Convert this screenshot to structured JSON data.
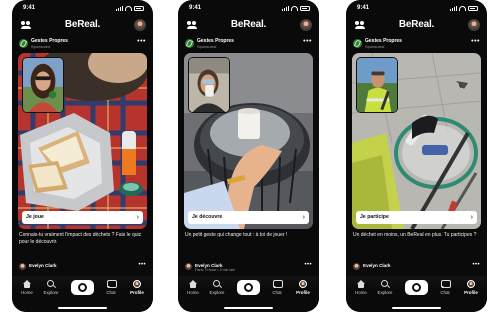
{
  "status_time": "9:41",
  "app_title": "BeReal.",
  "poster": {
    "name": "Gestes Propres",
    "subtitle": "Sponsored"
  },
  "commenter": {
    "name": "Evelyn Clark",
    "subtitle": "Paris, France • 3 min late"
  },
  "nav": {
    "home": "Home",
    "explore": "Explore",
    "chat": "Chat",
    "profile": "Profile"
  },
  "phones": [
    {
      "cta_label": "Je joue",
      "caption": "Connais-tu vraiment l'impact des déchets ? Fais le quiz pour le découvrir."
    },
    {
      "cta_label": "Je découvre",
      "caption": "Un petit geste qui change tout : à toi de jouer !"
    },
    {
      "cta_label": "Je participe",
      "caption": "Un déchet en moins, un BeReal en plus. Tu participes ?"
    }
  ],
  "icons": [
    "friends-icon",
    "more-icon",
    "chevron-right-icon",
    "home-icon",
    "search-icon",
    "camera-icon",
    "chat-icon",
    "profile-icon"
  ]
}
